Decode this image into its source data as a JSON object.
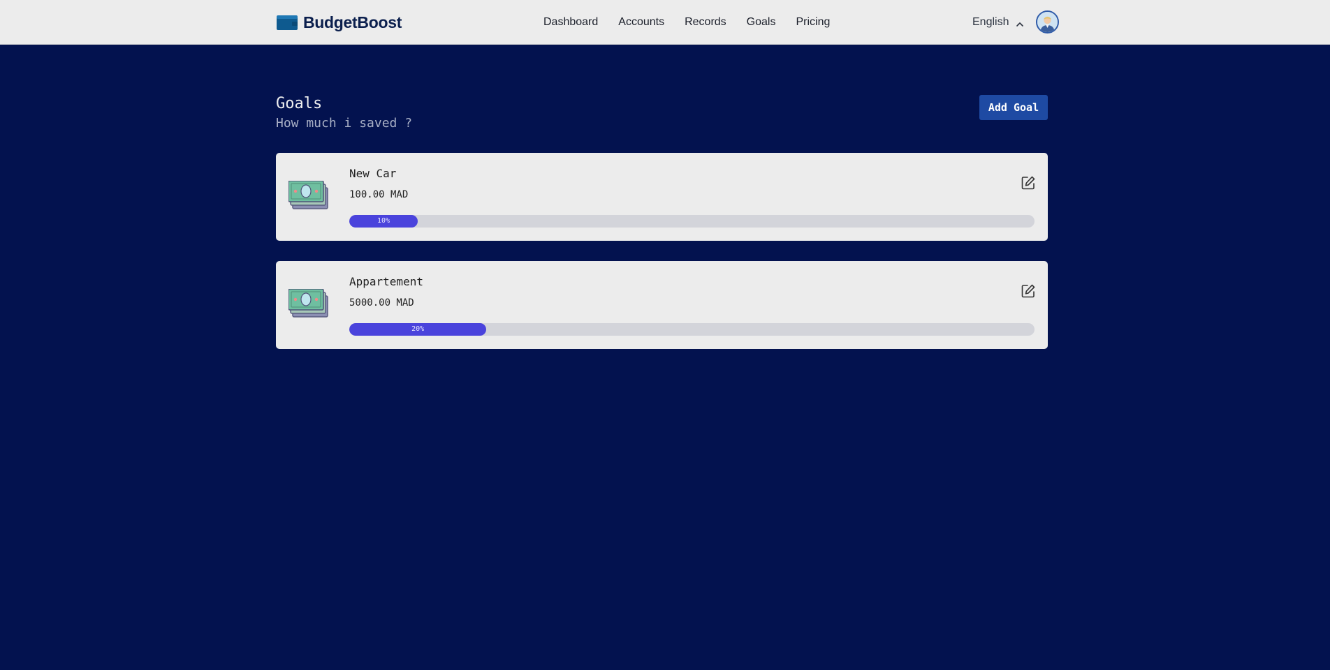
{
  "header": {
    "brand": "BudgetBoost",
    "nav": [
      "Dashboard",
      "Accounts",
      "Records",
      "Goals",
      "Pricing"
    ],
    "language": "English"
  },
  "main": {
    "title": "Goals",
    "subtitle": "How much i saved ?",
    "add_goal_label": "Add Goal",
    "goals": [
      {
        "name": "New Car",
        "amount": "100.00 MAD",
        "progress_label": "10%",
        "progress": 0.1
      },
      {
        "name": "Appartement",
        "amount": "5000.00 MAD",
        "progress_label": "20%",
        "progress": 0.2
      }
    ]
  },
  "colors": {
    "page_bg": "#03124f",
    "header_bg": "#ececec",
    "card_bg": "#ececec",
    "accent_button": "#1e4aa3",
    "progress_fill": "#4a43dc",
    "progress_track": "#d3d4da"
  },
  "icons": {
    "logo": "wallet-icon",
    "language_toggle": "chevron-up-icon",
    "goal": "money-stack-icon",
    "edit": "edit-icon"
  }
}
